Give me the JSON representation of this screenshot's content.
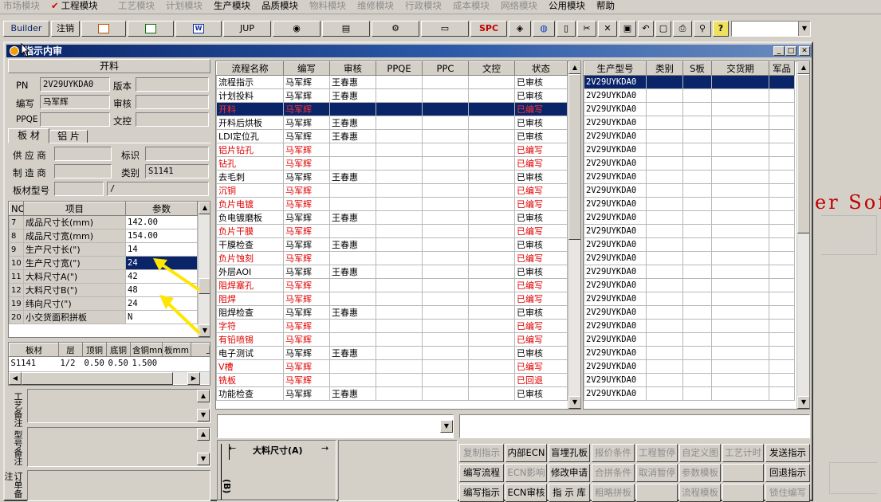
{
  "menu": [
    {
      "label": "市场模块",
      "enabled": false
    },
    {
      "label": "工程模块",
      "enabled": true,
      "checked": true
    },
    {
      "label": "工艺模块",
      "enabled": false
    },
    {
      "label": "计划模块",
      "enabled": false
    },
    {
      "label": "生产模块",
      "enabled": true
    },
    {
      "label": "品质模块",
      "enabled": true
    },
    {
      "label": "物料模块",
      "enabled": false
    },
    {
      "label": "维修模块",
      "enabled": false
    },
    {
      "label": "行政模块",
      "enabled": false
    },
    {
      "label": "成本模块",
      "enabled": false
    },
    {
      "label": "网络模块",
      "enabled": false
    },
    {
      "label": "公用模块",
      "enabled": true
    },
    {
      "label": "帮助",
      "enabled": true
    }
  ],
  "toolbar": {
    "builder": "Builder",
    "logout": "注销",
    "jup": "JUP",
    "spc": "SPC",
    "help_glyph": "?"
  },
  "window": {
    "title": "指示内审"
  },
  "left": {
    "section_title": "开料",
    "pn_label": "PN",
    "pn_value": "2V29UYKDA0",
    "version_label": "版本",
    "author_label": "编写",
    "author_value": "马军辉",
    "review_label": "审核",
    "ppqe_label": "PPQE",
    "doc_control_label": "文控",
    "tabs": [
      "板 材",
      "铝 片"
    ],
    "supplier_label": "供 应 商",
    "mark_label": "标识",
    "maker_label": "制 造 商",
    "category_label": "类别",
    "category_value": "S1141",
    "board_type_label": "板材型号",
    "board_type_value2": "/",
    "param_headers": [
      "NO",
      "项目",
      "参数"
    ],
    "params": [
      {
        "no": "7",
        "item": "成品尺寸长(mm)",
        "value": "142.00"
      },
      {
        "no": "8",
        "item": "成品尺寸宽(mm)",
        "value": "154.00"
      },
      {
        "no": "9",
        "item": "生产尺寸长(\")",
        "value": "14"
      },
      {
        "no": "10",
        "item": "生产尺寸宽(\")",
        "value": "24",
        "selected": true
      },
      {
        "no": "11",
        "item": "大料尺寸A(\")",
        "value": "42"
      },
      {
        "no": "12",
        "item": "大料尺寸B(\")",
        "value": "48"
      },
      {
        "no": "19",
        "item": "纬向尺寸(\")",
        "value": "24"
      },
      {
        "no": "20",
        "item": "小交货面积拼板",
        "value": "N"
      }
    ],
    "board_headers": [
      "板材",
      "层",
      "顶铜",
      "底铜",
      "含铜mm",
      "板mm",
      "上"
    ],
    "board_rows": [
      [
        "S1141",
        "1/2",
        "0.50",
        "0.50",
        "1.500",
        "",
        ""
      ]
    ],
    "remark1_label": "工艺备注",
    "remark2_label": "型号备注",
    "remark3_label": "订单备注"
  },
  "flow": {
    "headers": [
      "流程名称",
      "编写",
      "审核",
      "PPQE",
      "PPC",
      "文控",
      "状态"
    ],
    "rows": [
      {
        "name": "流程指示",
        "author": "马军辉",
        "reviewer": "王春惠",
        "status": "已审核",
        "red": false
      },
      {
        "name": "计划投料",
        "author": "马军辉",
        "reviewer": "王春惠",
        "status": "已审核",
        "red": false
      },
      {
        "name": "开料",
        "author": "马军辉",
        "reviewer": "",
        "status": "已编写",
        "red": true,
        "selected": true
      },
      {
        "name": "开料后烘板",
        "author": "马军辉",
        "reviewer": "王春惠",
        "status": "已审核",
        "red": false
      },
      {
        "name": "LDI定位孔",
        "author": "马军辉",
        "reviewer": "王春惠",
        "status": "已审核",
        "red": false
      },
      {
        "name": "铝片钻孔",
        "author": "马军辉",
        "reviewer": "",
        "status": "已编写",
        "red": true
      },
      {
        "name": "钻孔",
        "author": "马军辉",
        "reviewer": "",
        "status": "已编写",
        "red": true
      },
      {
        "name": "去毛刺",
        "author": "马军辉",
        "reviewer": "王春惠",
        "status": "已审核",
        "red": false
      },
      {
        "name": "沉铜",
        "author": "马军辉",
        "reviewer": "",
        "status": "已编写",
        "red": true
      },
      {
        "name": "负片电镀",
        "author": "马军辉",
        "reviewer": "",
        "status": "已编写",
        "red": true
      },
      {
        "name": "负电镀磨板",
        "author": "马军辉",
        "reviewer": "王春惠",
        "status": "已审核",
        "red": false
      },
      {
        "name": "负片干膜",
        "author": "马军辉",
        "reviewer": "",
        "status": "已编写",
        "red": true
      },
      {
        "name": "干膜检查",
        "author": "马军辉",
        "reviewer": "王春惠",
        "status": "已审核",
        "red": false
      },
      {
        "name": "负片蚀刻",
        "author": "马军辉",
        "reviewer": "",
        "status": "已编写",
        "red": true
      },
      {
        "name": "外层AOI",
        "author": "马军辉",
        "reviewer": "王春惠",
        "status": "已审核",
        "red": false
      },
      {
        "name": "阻焊塞孔",
        "author": "马军辉",
        "reviewer": "",
        "status": "已编写",
        "red": true
      },
      {
        "name": "阻焊",
        "author": "马军辉",
        "reviewer": "",
        "status": "已编写",
        "red": true
      },
      {
        "name": "阻焊检查",
        "author": "马军辉",
        "reviewer": "王春惠",
        "status": "已审核",
        "red": false
      },
      {
        "name": "字符",
        "author": "马军辉",
        "reviewer": "",
        "status": "已编写",
        "red": true
      },
      {
        "name": "有铅喷锡",
        "author": "马军辉",
        "reviewer": "",
        "status": "已编写",
        "red": true
      },
      {
        "name": "电子测试",
        "author": "马军辉",
        "reviewer": "王春惠",
        "status": "已审核",
        "red": false
      },
      {
        "name": "V槽",
        "author": "马军辉",
        "reviewer": "",
        "status": "已编写",
        "red": true
      },
      {
        "name": "铣板",
        "author": "马军辉",
        "reviewer": "",
        "status": "已回退",
        "red": true
      },
      {
        "name": "功能检查",
        "author": "马军辉",
        "reviewer": "王春惠",
        "status": "已审核",
        "red": false
      }
    ]
  },
  "orders": {
    "headers": [
      "生产型号",
      "类别",
      "S板",
      "交货期",
      "军品"
    ],
    "model": "2V29UYKDA0",
    "count": 24
  },
  "diagram": {
    "label": "大料尺寸(A)",
    "side_label": "(B)"
  },
  "background_text": "er Sof",
  "buttons": [
    [
      {
        "label": "复制指示",
        "enabled": false
      },
      {
        "label": "内部ECN",
        "enabled": true
      },
      {
        "label": "盲埋孔板",
        "enabled": true
      },
      {
        "label": "报价条件",
        "enabled": false
      },
      {
        "label": "工程暂停",
        "enabled": false
      },
      {
        "label": "自定义图",
        "enabled": false
      },
      {
        "label": "工艺计时",
        "enabled": false
      },
      {
        "label": "发送指示",
        "enabled": true
      }
    ],
    [
      {
        "label": "编写流程",
        "enabled": true
      },
      {
        "label": "ECN影响",
        "enabled": false
      },
      {
        "label": "修改申请",
        "enabled": true
      },
      {
        "label": "合拼条件",
        "enabled": false
      },
      {
        "label": "取消暂停",
        "enabled": false
      },
      {
        "label": "参数模板",
        "enabled": false
      },
      {
        "label": "",
        "enabled": false
      },
      {
        "label": "回退指示",
        "enabled": true
      }
    ],
    [
      {
        "label": "编写指示",
        "enabled": true
      },
      {
        "label": "ECN审核",
        "enabled": true
      },
      {
        "label": "指 示 库",
        "enabled": true
      },
      {
        "label": "粗略拼板",
        "enabled": false
      },
      {
        "label": "",
        "enabled": false
      },
      {
        "label": "流程模板",
        "enabled": false
      },
      {
        "label": "",
        "enabled": false
      },
      {
        "label": "锁住编写",
        "enabled": false
      }
    ]
  ]
}
